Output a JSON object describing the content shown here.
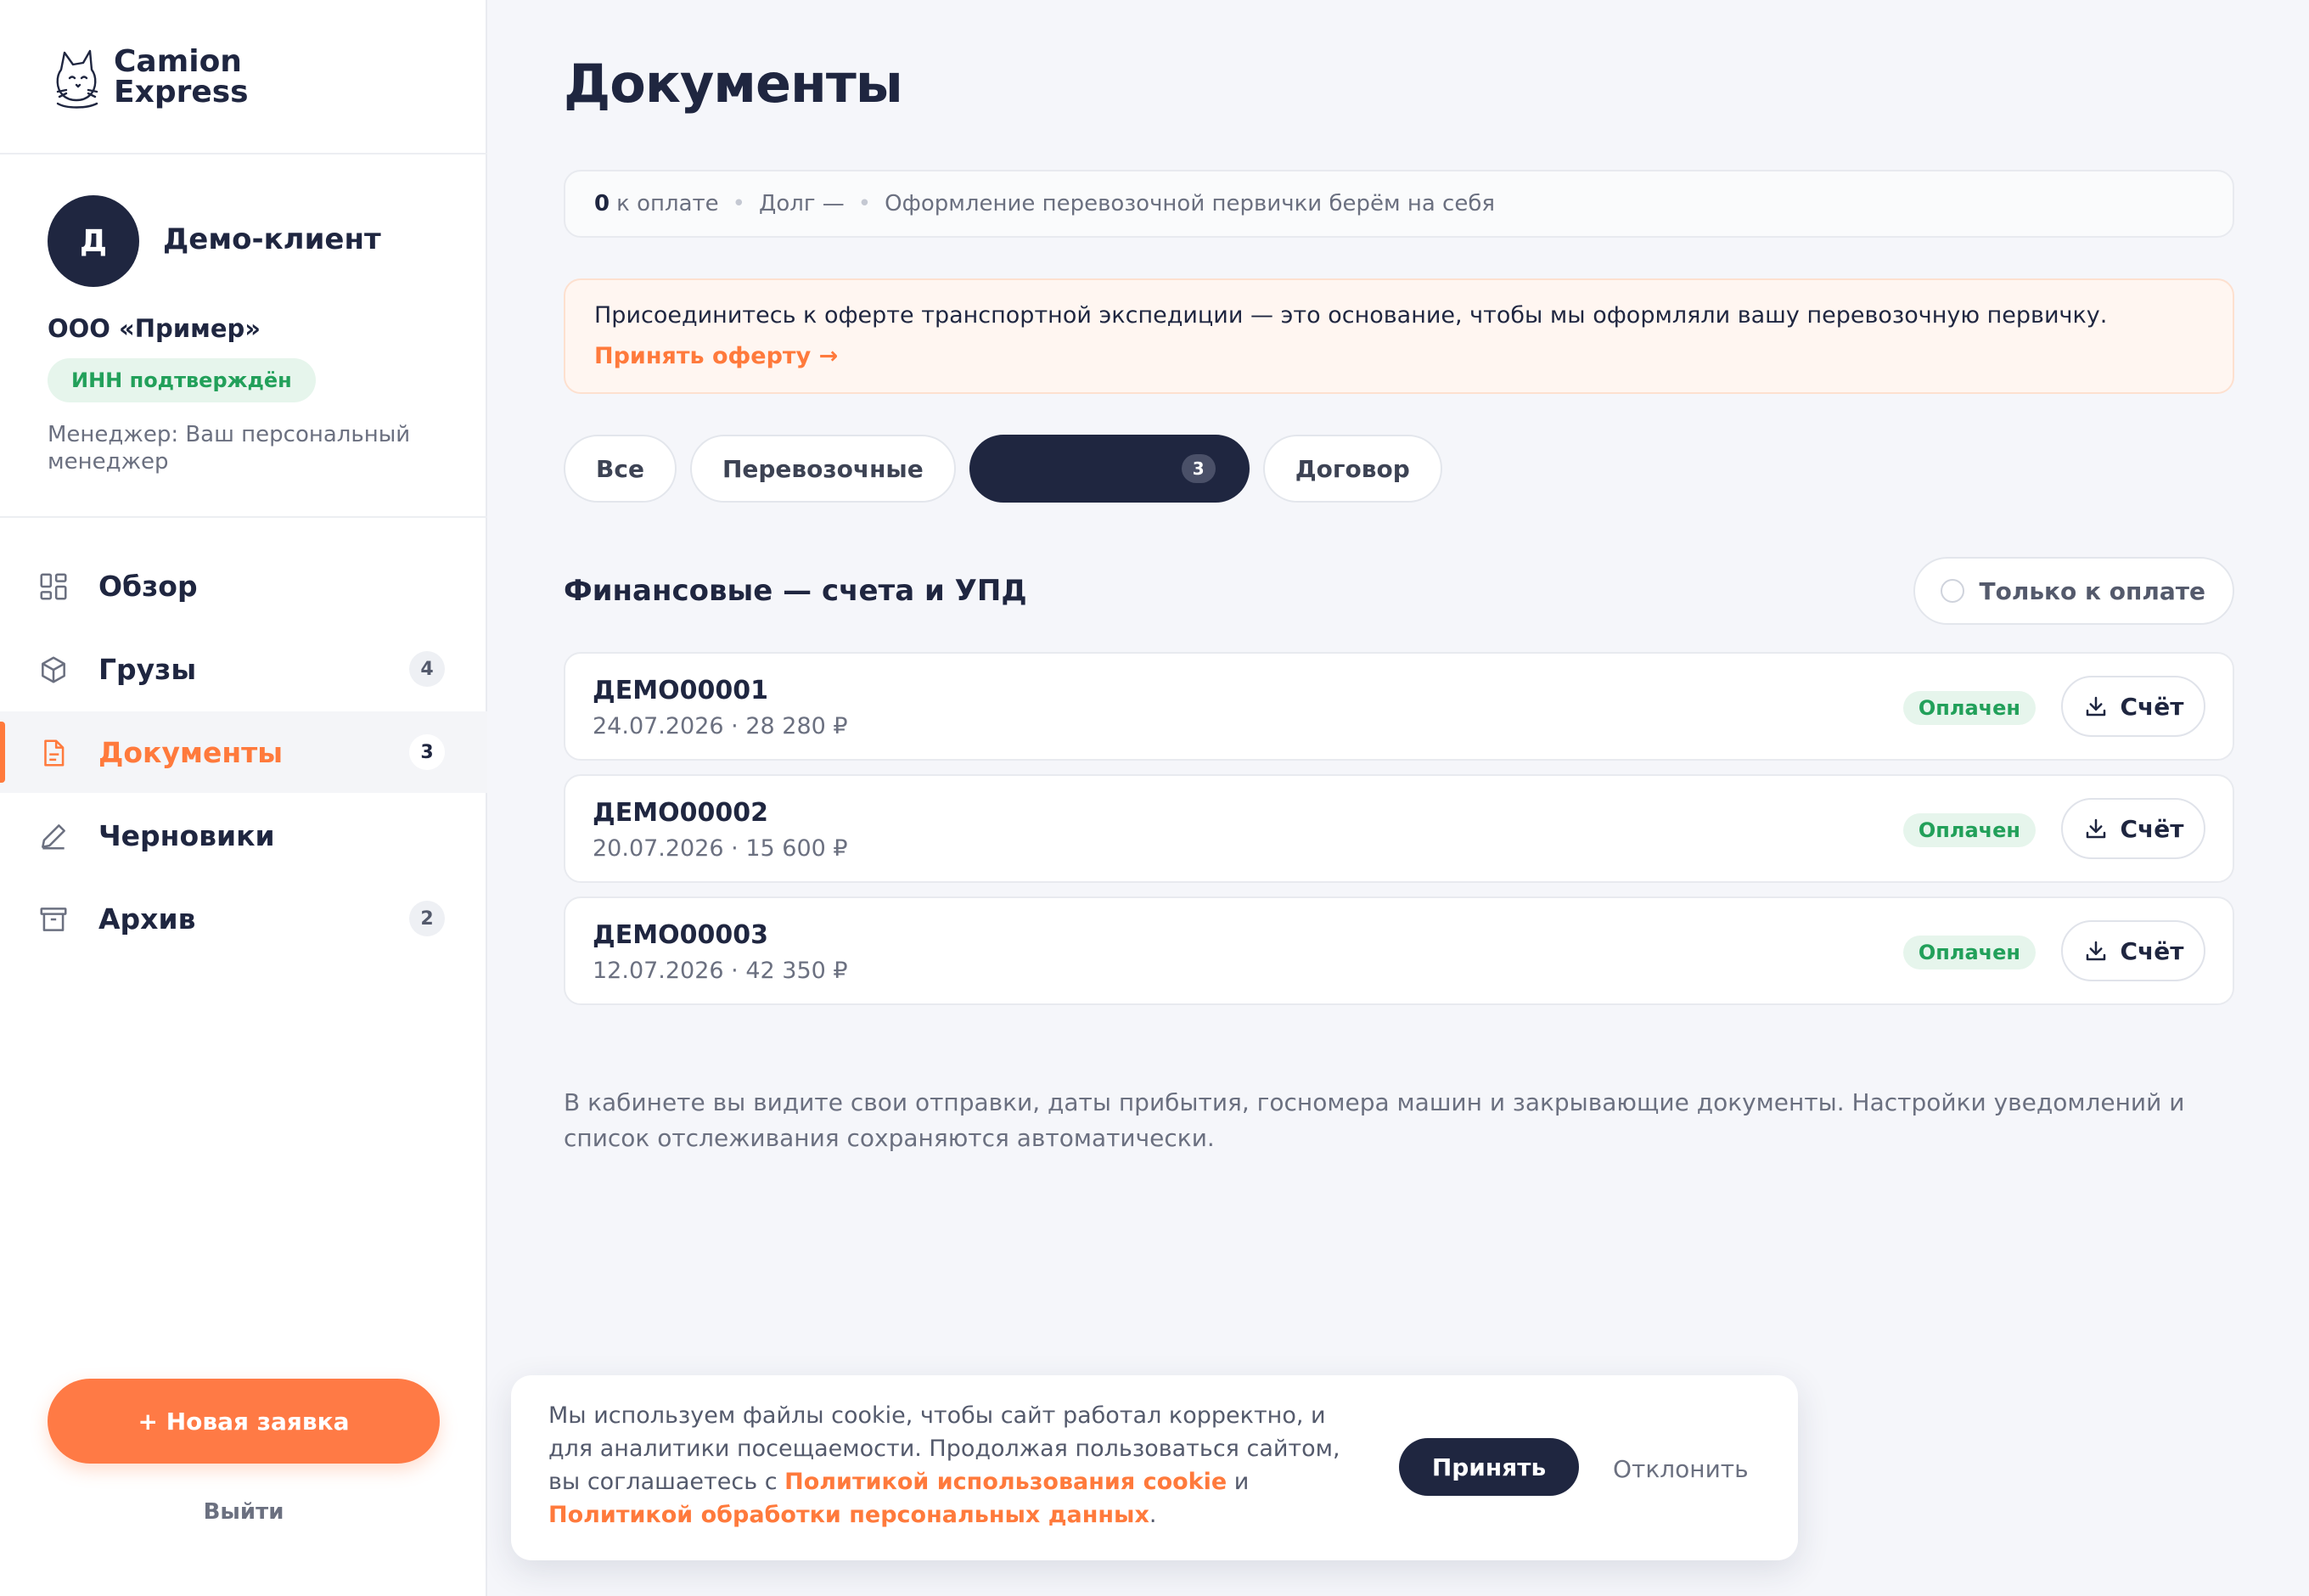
{
  "brand": {
    "line1": "Camion",
    "line2": "Express"
  },
  "profile": {
    "avatar_letter": "Д",
    "name": "Демо-клиент",
    "company": "ООО «Пример»",
    "inn_status": "ИНН подтверждён",
    "manager": "Менеджер: Ваш персональный менеджер"
  },
  "nav": [
    {
      "label": "Обзор",
      "icon": "dashboard-icon",
      "count": ""
    },
    {
      "label": "Грузы",
      "icon": "box-icon",
      "count": "4"
    },
    {
      "label": "Документы",
      "icon": "document-icon",
      "count": "3",
      "active": true
    },
    {
      "label": "Черновики",
      "icon": "pencil-icon",
      "count": ""
    },
    {
      "label": "Архив",
      "icon": "archive-icon",
      "count": "2"
    }
  ],
  "sidebar_actions": {
    "new_request": "+ Новая заявка",
    "logout": "Выйти"
  },
  "page": {
    "title": "Документы",
    "summary": {
      "to_pay_value": "0",
      "to_pay_label": "к оплате",
      "debt": "Долг —",
      "note": "Оформление перевозочной первички берём на себя"
    },
    "notice": {
      "text": "Присоединитесь к оферте транспортной экспедиции — это основание, чтобы мы оформляли вашу перевозочную первичку.",
      "link": "Принять оферту →"
    },
    "tabs": [
      {
        "label": "Все"
      },
      {
        "label": "Перевозочные"
      },
      {
        "label": "",
        "count": "3",
        "active": true
      },
      {
        "label": "Договор"
      }
    ],
    "section_title": "Финансовые — счета и УПД",
    "filter_label": "Только к оплате",
    "documents": [
      {
        "id": "ДЕМО00001",
        "meta": "24.07.2026 · 28 280 ₽",
        "status": "Оплачен",
        "button": "Счёт"
      },
      {
        "id": "ДЕМО00002",
        "meta": "20.07.2026 · 15 600 ₽",
        "status": "Оплачен",
        "button": "Счёт"
      },
      {
        "id": "ДЕМО00003",
        "meta": "12.07.2026 · 42 350 ₽",
        "status": "Оплачен",
        "button": "Счёт"
      }
    ],
    "footnote": "В кабинете вы видите свои отправки, даты прибытия, госномера машин и закрывающие документы. Настройки уведомлений и список отслеживания сохраняются автоматически."
  },
  "cookie": {
    "text_before": "Мы используем файлы cookie, чтобы сайт работал корректно, и для аналитики посещаемости. Продолжая пользоваться сайтом, вы соглашаетесь с ",
    "link1": "Политикой использования cookie",
    "and": " и ",
    "link2": "Политикой обработки персональных данных",
    "period": ".",
    "accept": "Принять",
    "decline": "Отклонить"
  },
  "colors": {
    "accent": "#ff7a3c",
    "navy": "#1f2640",
    "success": "#22a05a",
    "background": "#f5f6fa"
  }
}
